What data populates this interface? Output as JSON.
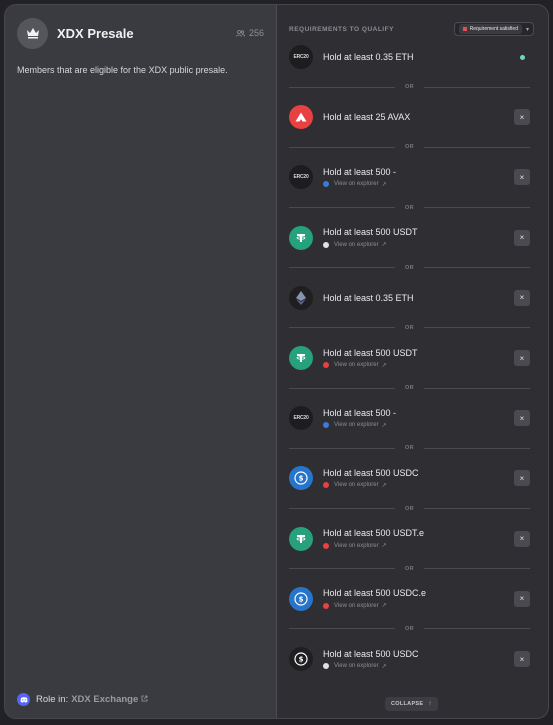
{
  "role": {
    "name": "XDX Presale",
    "member_count": "256",
    "description": "Members that are eligible for the XDX public presale.",
    "role_in_label": "Role in:",
    "guild_name": "XDX Exchange"
  },
  "requirements": {
    "title": "REQUIREMENTS TO QUALIFY",
    "filter_value": "Requirement satisfied",
    "or_label": "OR",
    "collapse_label": "COLLAPSE",
    "explorer_label": "View on explorer",
    "erc20_label": "ERC20",
    "items": [
      {
        "text": "Hold at least 0.35 ETH",
        "icon": "erc20-icon",
        "explorer": false,
        "status": "satisfied-dot"
      },
      {
        "text": "Hold at least 25 AVAX",
        "icon": "avalanche-icon",
        "explorer": false,
        "status": "x"
      },
      {
        "text": "Hold at least 500 -",
        "icon": "erc20-icon",
        "explorer": true,
        "chain": "#3c7bd9",
        "status": "x"
      },
      {
        "text": "Hold at least 500 USDT",
        "icon": "tether-icon",
        "explorer": true,
        "chain": "#e2e2e2",
        "status": "x"
      },
      {
        "text": "Hold at least 0.35 ETH",
        "icon": "ethereum-icon",
        "explorer": false,
        "status": "x"
      },
      {
        "text": "Hold at least 500 USDT",
        "icon": "tether-icon",
        "explorer": true,
        "chain": "#e84142",
        "status": "x"
      },
      {
        "text": "Hold at least 500 -",
        "icon": "erc20-icon",
        "explorer": true,
        "chain": "#3c7bd9",
        "status": "x"
      },
      {
        "text": "Hold at least 500 USDC",
        "icon": "usdc-icon",
        "explorer": true,
        "chain": "#e84142",
        "status": "x"
      },
      {
        "text": "Hold at least 500 USDT.e",
        "icon": "tether-icon",
        "explorer": true,
        "chain": "#e84142",
        "status": "x"
      },
      {
        "text": "Hold at least 500 USDC.e",
        "icon": "usdc-icon",
        "explorer": true,
        "chain": "#e84142",
        "status": "x"
      },
      {
        "text": "Hold at least 500 USDC",
        "icon": "usdc-icon",
        "explorer": true,
        "chain": "#e2e2e2",
        "status": "x"
      }
    ]
  },
  "colors": {
    "accent_satisfied": "#6fd6c0",
    "discord": "#5865f2",
    "avalanche": "#e84142",
    "tether": "#26a17b",
    "usdc": "#2775ca"
  }
}
